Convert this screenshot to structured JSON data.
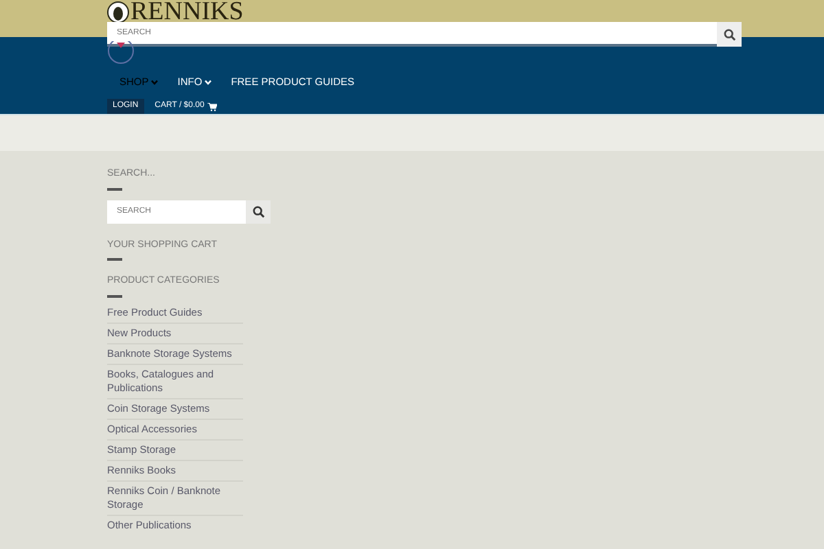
{
  "header": {
    "logo": "RENNIKS",
    "search": {
      "placeholder": "SEARCH"
    }
  },
  "nav": [
    {
      "label": "SHOP",
      "dropdown": true,
      "selected": true
    },
    {
      "label": "INFO",
      "dropdown": true,
      "selected": false
    },
    {
      "label": "FREE PRODUCT GUIDES",
      "dropdown": false,
      "selected": false
    }
  ],
  "account": {
    "login": "LOGIN",
    "cart": "CART / $0.00"
  },
  "sidebar": {
    "search_title": "SEARCH...",
    "search": {
      "placeholder": "SEARCH"
    },
    "cart_title": "YOUR SHOPPING CART",
    "categories_title": "PRODUCT CATEGORIES",
    "categories": [
      "Free Product Guides",
      "New Products",
      "Banknote Storage Systems",
      "Books, Catalogues and Publications",
      "Coin Storage Systems",
      "Optical Accessories",
      "Stamp Storage",
      "Renniks Books",
      "Renniks Coin / Banknote Storage",
      "Other Publications"
    ]
  }
}
